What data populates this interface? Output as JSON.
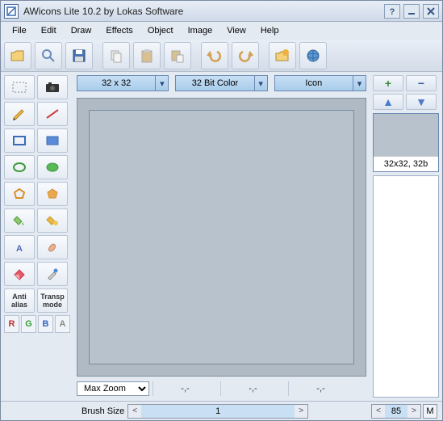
{
  "titlebar": {
    "title": "AWicons Lite 10.2 by Lokas Software"
  },
  "menubar": {
    "items": [
      "File",
      "Edit",
      "Draw",
      "Effects",
      "Object",
      "Image",
      "View",
      "Help"
    ]
  },
  "dropdowns": {
    "size": "32 x 32",
    "color": "32 Bit Color",
    "type": "Icon"
  },
  "tools": {
    "antialias": "Anti\nalias",
    "transp": "Transp\nmode",
    "rgba": [
      "R",
      "G",
      "B",
      "A"
    ]
  },
  "zoom": {
    "label": "Max Zoom"
  },
  "coords": {
    "c1": "-,-",
    "c2": "-,-",
    "c3": "-,-"
  },
  "preview": {
    "label": "32x32, 32b"
  },
  "status": {
    "brush_label": "Brush Size",
    "brush_value": "1",
    "page_value": "85",
    "m_label": "M"
  },
  "icons": {
    "plus": "+",
    "minus": "−",
    "up": "▲",
    "down": "▼",
    "arrow": "▾",
    "left": "<",
    "right": ">"
  }
}
